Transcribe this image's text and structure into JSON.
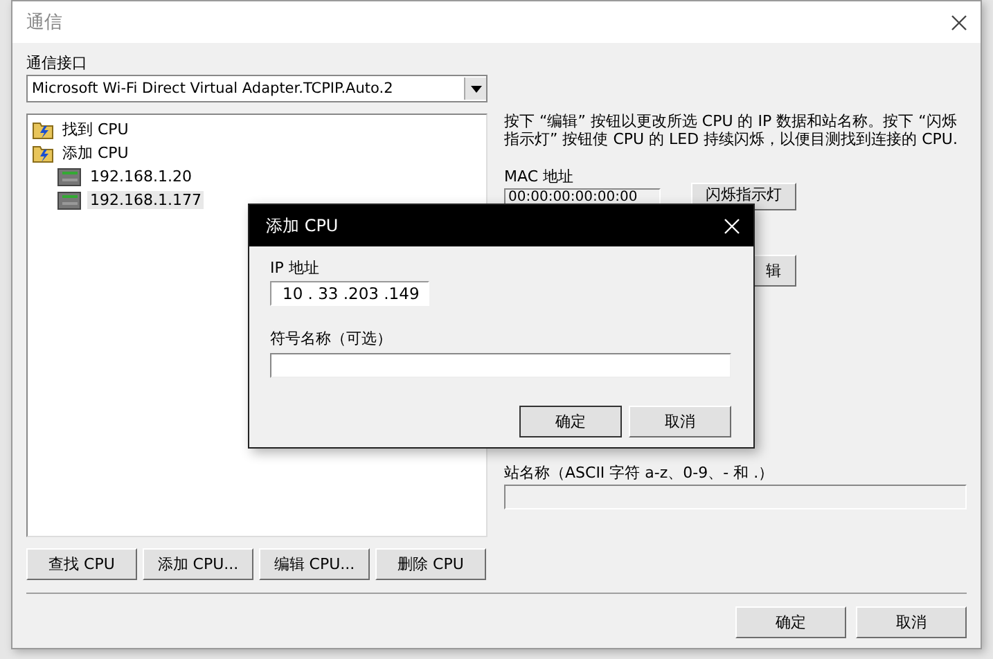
{
  "window": {
    "title": "通信"
  },
  "interface": {
    "label": "通信接口",
    "value": "Microsoft Wi-Fi Direct Virtual Adapter.TCPIP.Auto.2"
  },
  "tree": [
    {
      "label": "找到 CPU",
      "kind": "folder",
      "selected": false
    },
    {
      "label": "添加 CPU",
      "kind": "folder",
      "selected": false,
      "children": [
        {
          "label": "192.168.1.20",
          "kind": "device",
          "selected": false
        },
        {
          "label": "192.168.1.177",
          "kind": "device",
          "selected": true
        }
      ]
    }
  ],
  "left_buttons": [
    "查找 CPU",
    "添加 CPU...",
    "编辑 CPU...",
    "删除 CPU"
  ],
  "description": "按下 “编辑” 按钮以更改所选 CPU 的 IP 数据和站名称。按下 “闪烁指示灯” 按钮使 CPU 的 LED 持续闪烁，以便目测找到连接的 CPU.",
  "mac": {
    "label": "MAC 地址",
    "value": "00:00:00:00:00:00"
  },
  "blink_button": "闪烁指示灯",
  "edit_button": "辑",
  "station": {
    "label": "站名称（ASCII 字符 a-z、0-9、- 和 .）"
  },
  "buttons": [
    "确定",
    "取消"
  ],
  "dialog": {
    "title": "添加 CPU",
    "ip_label": "IP 地址",
    "ip": "10 . 33 .203 .149",
    "name_label": "符号名称（可选）",
    "buttons": [
      "确定",
      "取消"
    ]
  }
}
